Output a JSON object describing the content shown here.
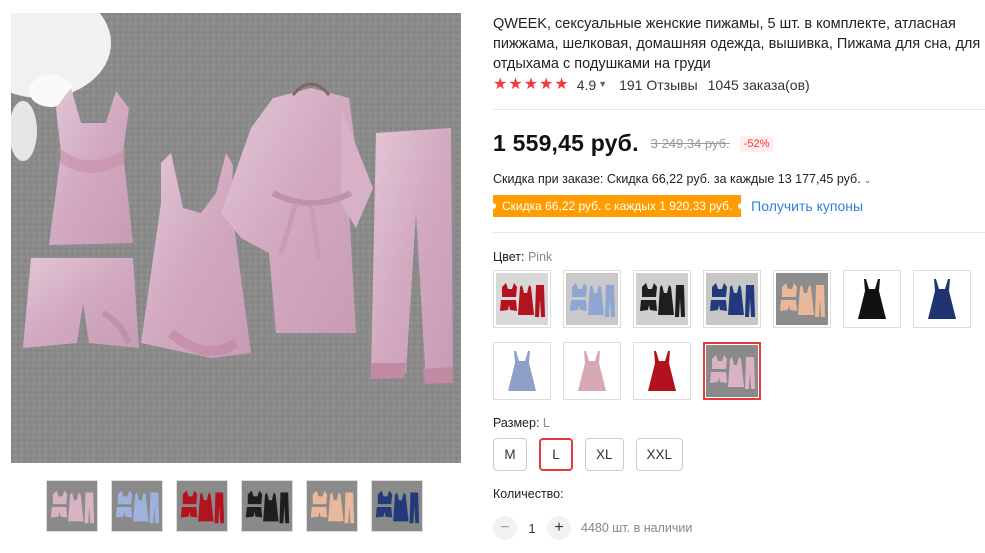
{
  "product": {
    "title": "QWEEK, сексуальные женские пижамы, 5 шт. в комплекте, атласная пижжама, шелковая, домашняя одежда, вышивка, Пижама для сна, для отдыхама с подушками на груди",
    "rating": "4.9",
    "reviews": "191 Отзывы",
    "orders": "1045 заказа(ов)",
    "star_count": 5,
    "star_color": "#f03a3a"
  },
  "pricing": {
    "price": "1 559,45 руб.",
    "old_price": "3 249,34 руб.",
    "discount": "-52%",
    "order_discount": "Скидка при заказе: Скидка 66,22 руб. за каждые 13 177,45 руб.",
    "coupon": "Скидка 66,22 руб. с каждых 1 920,33 руб.",
    "get_coupons": "Получить купоны",
    "coupon_color": "#ff9c00",
    "link_color": "#2f7fe0"
  },
  "color_option": {
    "label": "Цвет:",
    "value": "Pink",
    "swatches": [
      {
        "name": "red-set",
        "bg": "#d8d8d8",
        "fill": "#b3121f"
      },
      {
        "name": "blue-set",
        "bg": "#c9c9c9",
        "fill": "#8fa6d3"
      },
      {
        "name": "black-set",
        "bg": "#cfcfcf",
        "fill": "#1e1e1e"
      },
      {
        "name": "navy-set",
        "bg": "#c6c6c6",
        "fill": "#223a7a"
      },
      {
        "name": "champagne-set",
        "bg": "#8c8c8c",
        "fill": "#e9b79a"
      },
      {
        "name": "black-gown",
        "bg": "#ffffff",
        "fill": "#111111"
      },
      {
        "name": "navy-gown",
        "bg": "#ffffff",
        "fill": "#1f3471"
      },
      {
        "name": "blue-gown",
        "bg": "#ffffff",
        "fill": "#8ea0c8"
      },
      {
        "name": "pink-gown",
        "bg": "#ffffff",
        "fill": "#d6a9b2"
      },
      {
        "name": "red-gown",
        "bg": "#ffffff",
        "fill": "#b2121e"
      },
      {
        "name": "pink-set",
        "bg": "#8a8a8a",
        "fill": "#d9b3c4"
      }
    ],
    "selected_index": 10,
    "selected_color": "#e83a3a"
  },
  "size_option": {
    "label": "Размер:",
    "value": "L",
    "sizes": [
      "M",
      "L",
      "XL",
      "XXL"
    ],
    "selected_index": 1
  },
  "quantity": {
    "label": "Количество:",
    "minus": "−",
    "value": "1",
    "plus": "+",
    "stock": "4480 шт. в наличии"
  },
  "gallery": {
    "thumbs": [
      {
        "name": "pink",
        "fill": "#d9b3c4"
      },
      {
        "name": "blue",
        "fill": "#9fb2dd"
      },
      {
        "name": "red",
        "fill": "#b3121f"
      },
      {
        "name": "black",
        "fill": "#1e1e1e"
      },
      {
        "name": "champagne",
        "fill": "#e9b79a"
      },
      {
        "name": "navy",
        "fill": "#223a7a"
      }
    ]
  }
}
